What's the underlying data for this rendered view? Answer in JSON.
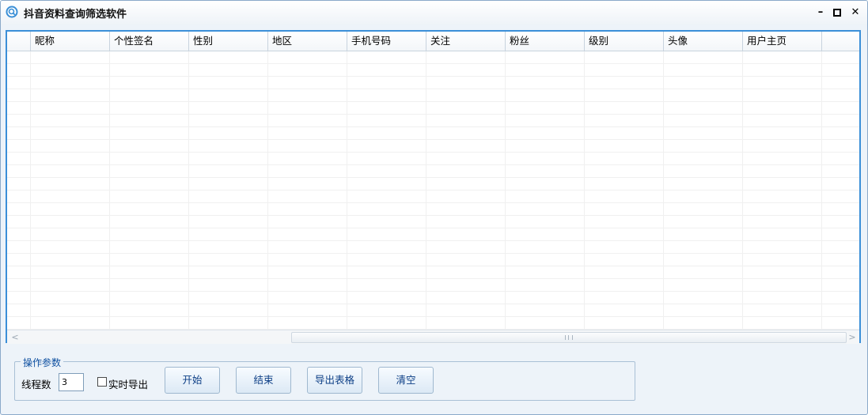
{
  "window": {
    "title": "抖音资料查询筛选软件",
    "controls": {
      "minimize": "–",
      "maximize": "▫",
      "close": "✕"
    }
  },
  "grid": {
    "columns": [
      "昵称",
      "个性签名",
      "性别",
      "地区",
      "手机号码",
      "关注",
      "粉丝",
      "级别",
      "头像",
      "用户主页"
    ],
    "rows": []
  },
  "params": {
    "group_title": "操作参数",
    "thread_label": "线程数",
    "thread_value": "3",
    "realtime_export_label": "实时导出",
    "realtime_export_checked": false,
    "buttons": {
      "start": "开始",
      "stop": "结束",
      "export": "导出表格",
      "clear": "清空"
    }
  },
  "colors": {
    "accent": "#3b8fd8",
    "button_text": "#0d3f86",
    "group_title": "#0d4fa0"
  }
}
